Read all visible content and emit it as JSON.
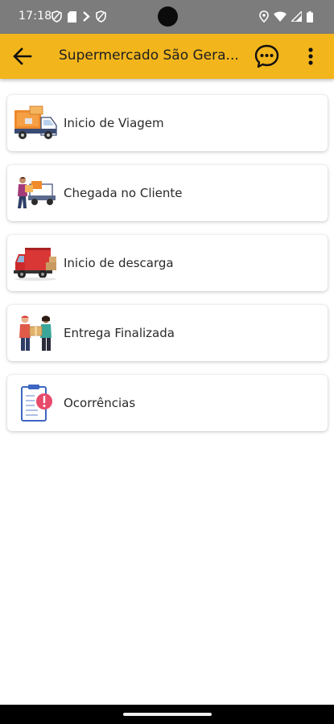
{
  "status_bar": {
    "time": "17:18",
    "left_icons": [
      "shield-icon",
      "sim-card-icon",
      "play-arrow-icon",
      "shield-icon"
    ],
    "right_icons": [
      "location-pin-icon",
      "wifi-icon",
      "signal-icon",
      "battery-icon"
    ]
  },
  "app_bar": {
    "title": "Supermercado São Gera...",
    "background_color": "#f2b51c",
    "back_icon": "arrow-back-icon",
    "chat_icon": "chat-bubble-icon",
    "more_icon": "more-vertical-icon"
  },
  "menu": {
    "items": [
      {
        "label": "Inicio de Viagem",
        "icon": "delivery-truck-icon"
      },
      {
        "label": "Chegada no Cliente",
        "icon": "courier-truck-icon"
      },
      {
        "label": "Inicio de descarga",
        "icon": "red-truck-unloading-icon"
      },
      {
        "label": "Entrega Finalizada",
        "icon": "package-handover-icon"
      },
      {
        "label": "Ocorrências",
        "icon": "clipboard-alert-icon"
      }
    ]
  }
}
